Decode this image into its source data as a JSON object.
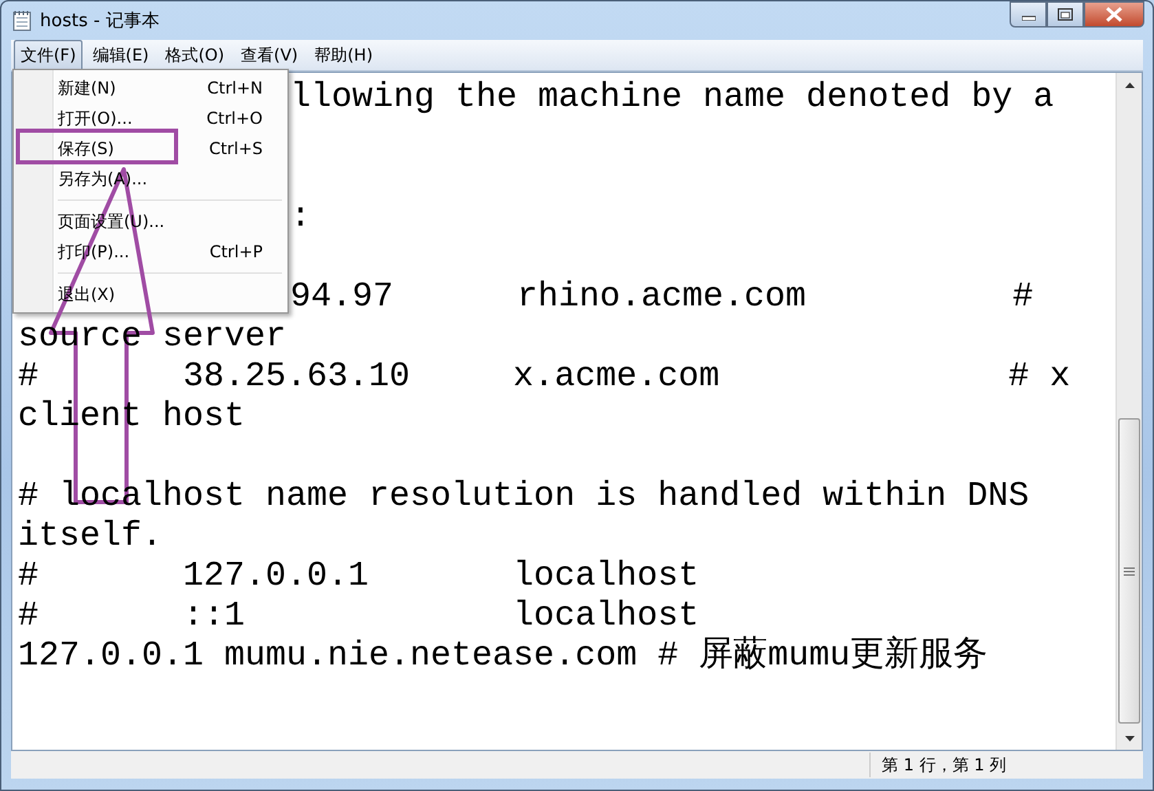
{
  "window": {
    "title": "hosts - 记事本"
  },
  "menu_bar": [
    {
      "label": "文件(F)",
      "selected": true
    },
    {
      "label": "编辑(E)",
      "selected": false
    },
    {
      "label": "格式(O)",
      "selected": false
    },
    {
      "label": "查看(V)",
      "selected": false
    },
    {
      "label": "帮助(H)",
      "selected": false
    }
  ],
  "file_menu": [
    {
      "kind": "item",
      "label": "新建(N)",
      "shortcut": "Ctrl+N"
    },
    {
      "kind": "item",
      "label": "打开(O)...",
      "shortcut": "Ctrl+O"
    },
    {
      "kind": "item",
      "label": "保存(S)",
      "shortcut": "Ctrl+S"
    },
    {
      "kind": "item",
      "label": "另存为(A)..."
    },
    {
      "kind": "separator"
    },
    {
      "kind": "item",
      "label": "页面设置(U)..."
    },
    {
      "kind": "item",
      "label": "打印(P)...",
      "shortcut": "Ctrl+P"
    },
    {
      "kind": "separator"
    },
    {
      "kind": "item",
      "label": "退出(X)"
    }
  ],
  "editor_lines": [
    {
      "kind": "partial",
      "text": "llowing the machine name denoted by a"
    },
    {
      "kind": "blank"
    },
    {
      "kind": "blank"
    },
    {
      "kind": "partial",
      "text": ":"
    },
    {
      "kind": "blank"
    },
    {
      "kind": "partial",
      "text": "94.97      rhino.acme.com          #"
    },
    {
      "kind": "full",
      "text": "source server"
    },
    {
      "kind": "full",
      "text": "#       38.25.63.10     x.acme.com              # x"
    },
    {
      "kind": "full",
      "text": "client host"
    },
    {
      "kind": "blank"
    },
    {
      "kind": "full",
      "text": "# localhost name resolution is handled within DNS"
    },
    {
      "kind": "full",
      "text": "itself."
    },
    {
      "kind": "full",
      "text": "#       127.0.0.1       localhost"
    },
    {
      "kind": "full",
      "text": "#       ::1             localhost"
    },
    {
      "kind": "full",
      "text": "127.0.0.1 mumu.nie.netease.com # 屏蔽mumu更新服务"
    }
  ],
  "status_bar": {
    "position": "第 1 行，第 1 列"
  }
}
